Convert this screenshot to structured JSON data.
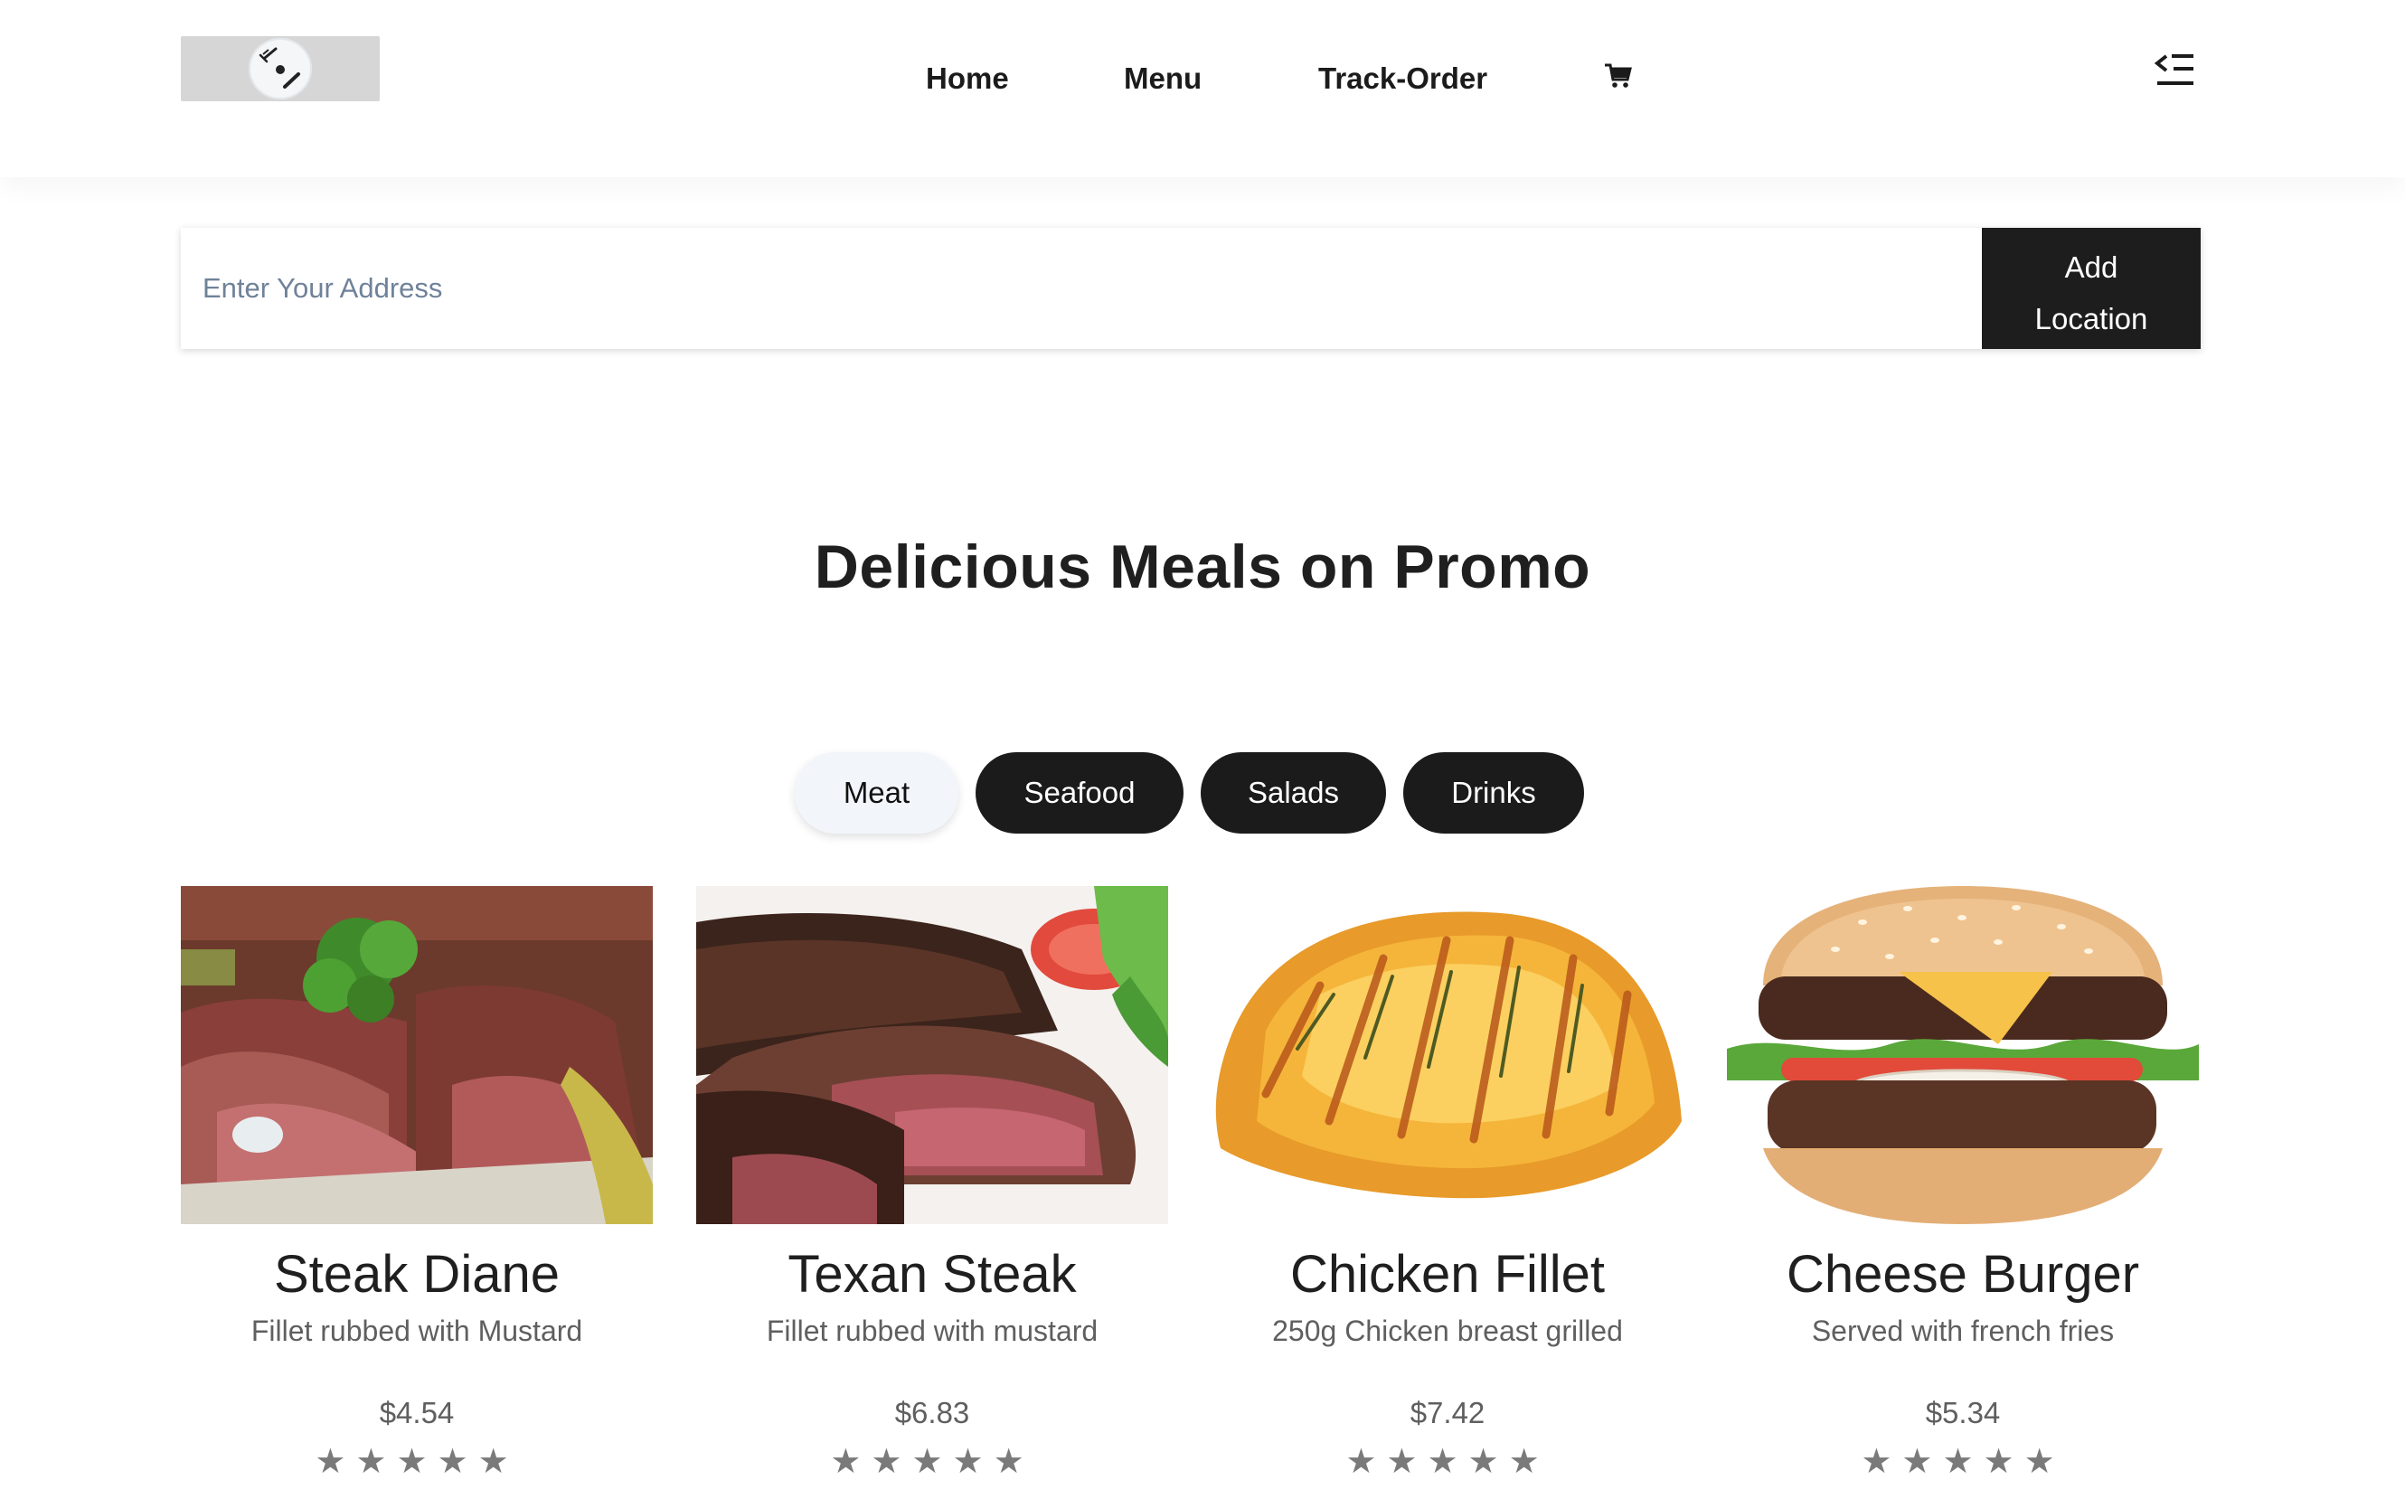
{
  "header": {
    "logo_icon": "plate-fork-knife-icon",
    "nav": {
      "home": "Home",
      "menu": "Menu",
      "track_order": "Track-Order"
    },
    "cart_icon": "shopping-cart-icon",
    "menu_toggle_icon": "menu-collapse-icon"
  },
  "address": {
    "placeholder": "Enter Your Address",
    "button_line1": "Add",
    "button_line2": "Location"
  },
  "promo": {
    "title": "Delicious Meals on Promo"
  },
  "categories": [
    {
      "label": "Meat",
      "active": true
    },
    {
      "label": "Seafood",
      "active": false
    },
    {
      "label": "Salads",
      "active": false
    },
    {
      "label": "Drinks",
      "active": false
    }
  ],
  "products": [
    {
      "name": "Steak Diane",
      "description": "Fillet rubbed with Mustard",
      "price": "$4.54",
      "rating_stars": 5,
      "image": "steak-diane-photo"
    },
    {
      "name": "Texan Steak",
      "description": "Fillet rubbed with mustard",
      "price": "$6.83",
      "rating_stars": 5,
      "image": "texan-steak-photo"
    },
    {
      "name": "Chicken Fillet",
      "description": "250g Chicken breast grilled",
      "price": "$7.42",
      "rating_stars": 5,
      "image": "chicken-fillet-photo"
    },
    {
      "name": "Cheese Burger",
      "description": "Served with french fries",
      "price": "$5.34",
      "rating_stars": 5,
      "image": "cheese-burger-photo"
    }
  ],
  "colors": {
    "dark": "#1b1b1b",
    "active_pill_bg": "#f2f6fb",
    "muted_text": "#5f5f5f",
    "placeholder_text": "#6f8299",
    "star": "#7a7a7a"
  }
}
